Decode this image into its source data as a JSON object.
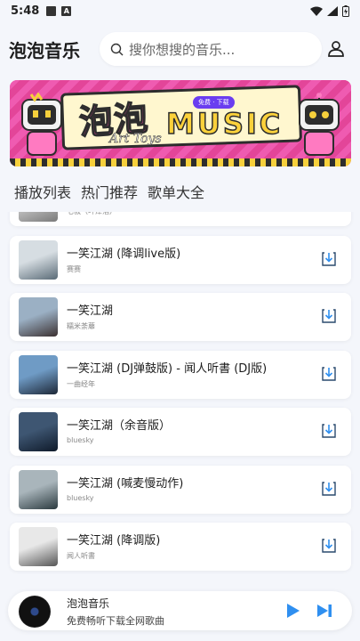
{
  "status_bar": {
    "time": "5:48"
  },
  "header": {
    "title": "泡泡音乐",
    "search_placeholder": "搜你想搜的音乐..."
  },
  "banner": {
    "title": "泡泡",
    "music": "MUSIC",
    "subtitle": "Art Toys",
    "badge": "免费 · 下载"
  },
  "tabs": [
    {
      "label": "播放列表",
      "active": true
    },
    {
      "label": "热门推荐",
      "active": false
    },
    {
      "label": "歌单大全",
      "active": false
    }
  ],
  "songs": [
    {
      "title": "",
      "artist": "七叔（叶泽浩）"
    },
    {
      "title": "一笑江湖 (降调live版)",
      "artist": "赛赛"
    },
    {
      "title": "一笑江湖",
      "artist": "糯米荼蘼"
    },
    {
      "title": "一笑江湖 (DJ弹鼓版) - 闻人听書 (DJ版)",
      "artist": "一曲经年"
    },
    {
      "title": "一笑江湖（余音版）",
      "artist": "bluesky"
    },
    {
      "title": "一笑江湖 (喊麦慢动作)",
      "artist": "bluesky"
    },
    {
      "title": "一笑江湖 (降调版)",
      "artist": "闻人听書"
    }
  ],
  "player": {
    "title": "泡泡音乐",
    "subtitle": "免费畅听下载全网歌曲"
  },
  "colors": {
    "accent": "#2f8ff0",
    "tab_indicator": "#23406b",
    "banner_pink": "#e94aa6"
  }
}
